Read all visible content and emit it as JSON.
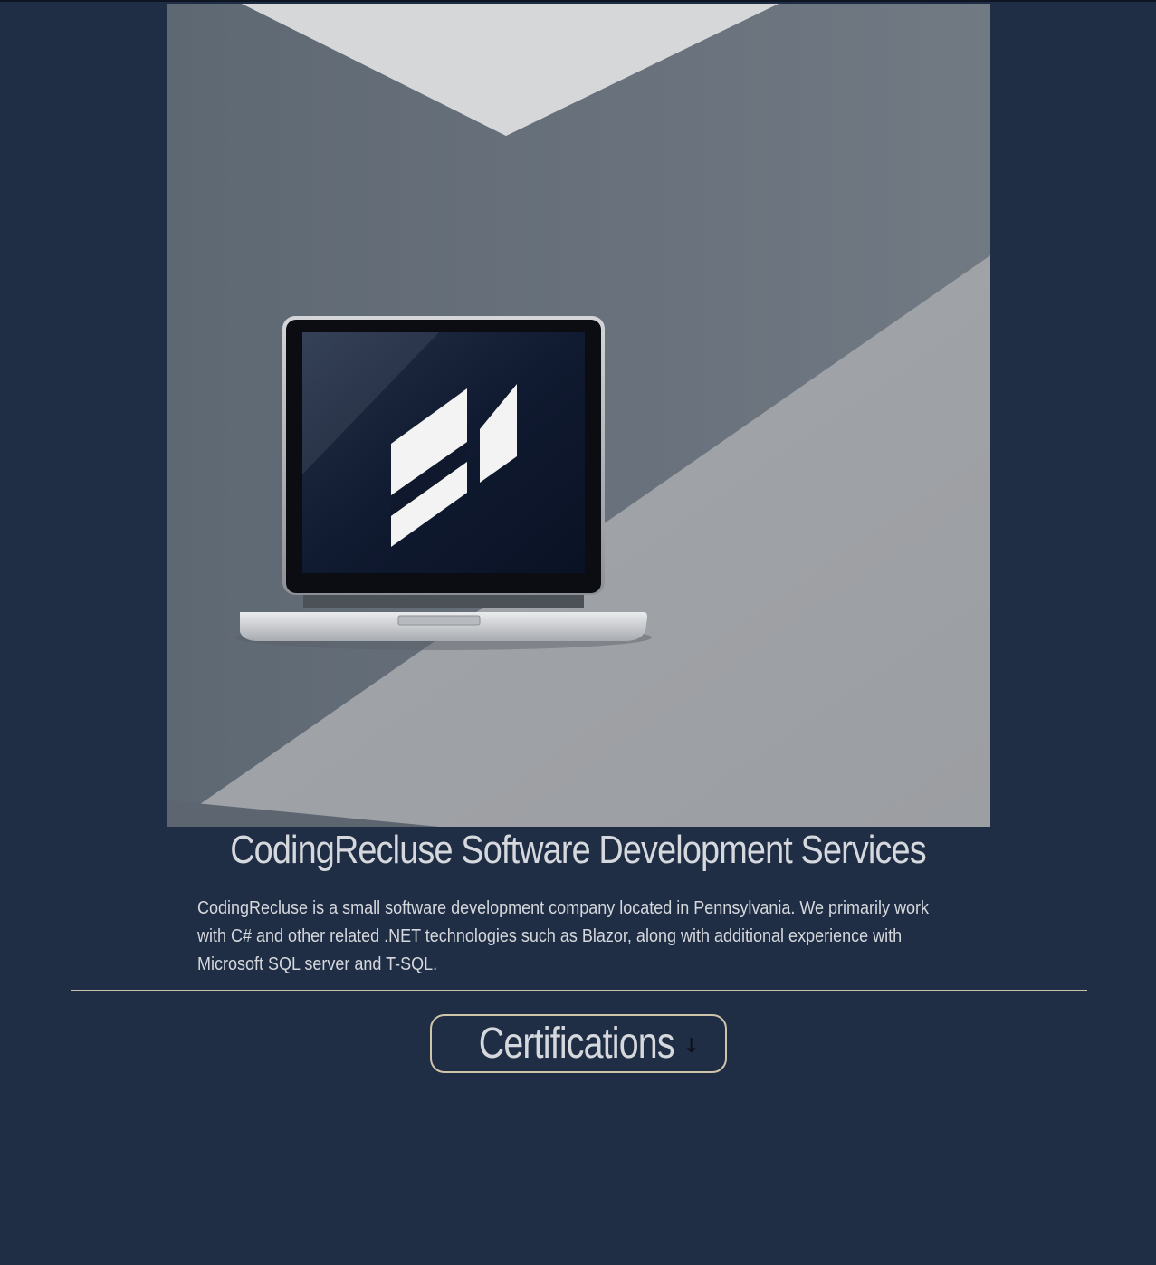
{
  "hero": {
    "image_alt": "Laptop displaying the CodingRecluse logo on a grey geometric background"
  },
  "header": {
    "title": "CodingRecluse Software Development Services"
  },
  "intro": {
    "description": "CodingRecluse is a small software development company located in Pennsylvania. We primarily work with C# and other related .NET technologies such as Blazor, along with additional experience with Microsoft SQL server and T-SQL."
  },
  "certifications": {
    "label": "Certifications",
    "icon": "arrow-down-icon"
  },
  "colors": {
    "background": "#1f2d45",
    "text": "#d5d8dc",
    "accent_border": "#cfc6aa"
  }
}
